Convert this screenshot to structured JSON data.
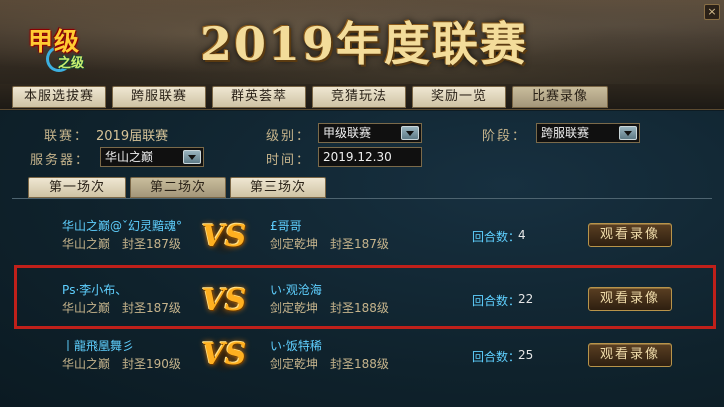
{
  "banner": {
    "logo_main": "甲级",
    "logo_sub": "之级",
    "title": "2019年度联赛",
    "close_label": "×"
  },
  "tabs": [
    {
      "label": "本服选拔赛",
      "active": false
    },
    {
      "label": "跨服联赛",
      "active": false
    },
    {
      "label": "群英荟萃",
      "active": false
    },
    {
      "label": "竞猜玩法",
      "active": false
    },
    {
      "label": "奖励一览",
      "active": false
    },
    {
      "label": "比赛录像",
      "active": true
    }
  ],
  "filters": {
    "league_label": "联赛：",
    "league_value": "2019届联赛",
    "server_label": "服务器：",
    "server_value": "华山之巅",
    "level_label": "级别：",
    "level_value": "甲级联赛",
    "time_label": "时间：",
    "time_value": "2019.12.30",
    "stage_label": "阶段：",
    "stage_value": "跨服联赛"
  },
  "rounds_tabs": [
    {
      "label": "第一场次",
      "active": false
    },
    {
      "label": "第二场次",
      "active": true
    },
    {
      "label": "第三场次",
      "active": false
    }
  ],
  "matches": [
    {
      "left_name": "华山之巅@ˇ幻灵黯魂°",
      "left_server": "华山之巅",
      "left_level": "封圣187级",
      "right_name": "£哥哥",
      "right_server": "剑定乾坤",
      "right_level": "封圣187级",
      "vs": "VS",
      "rounds_label": "回合数：",
      "rounds": "4",
      "replay_label": "观看录像",
      "highlighted": false
    },
    {
      "left_name": "Ρs·李小布、",
      "left_server": "华山之巅",
      "left_level": "封圣187级",
      "right_name": "い·观沧海",
      "right_server": "剑定乾坤",
      "right_level": "封圣188级",
      "vs": "VS",
      "rounds_label": "回合数：",
      "rounds": "22",
      "replay_label": "观看录像",
      "highlighted": true
    },
    {
      "left_name": "丨龍飛凰舞彡",
      "left_server": "华山之巅",
      "left_level": "封圣190级",
      "right_name": "い·饭特稀",
      "right_server": "剑定乾坤",
      "right_level": "封圣188级",
      "vs": "VS",
      "rounds_label": "回合数：",
      "rounds": "25",
      "replay_label": "观看录像",
      "highlighted": false
    }
  ],
  "colors": {
    "accent_cyan": "#5fd0ff",
    "highlight_red": "#c0201a",
    "vs_gold": "#ffb020"
  }
}
